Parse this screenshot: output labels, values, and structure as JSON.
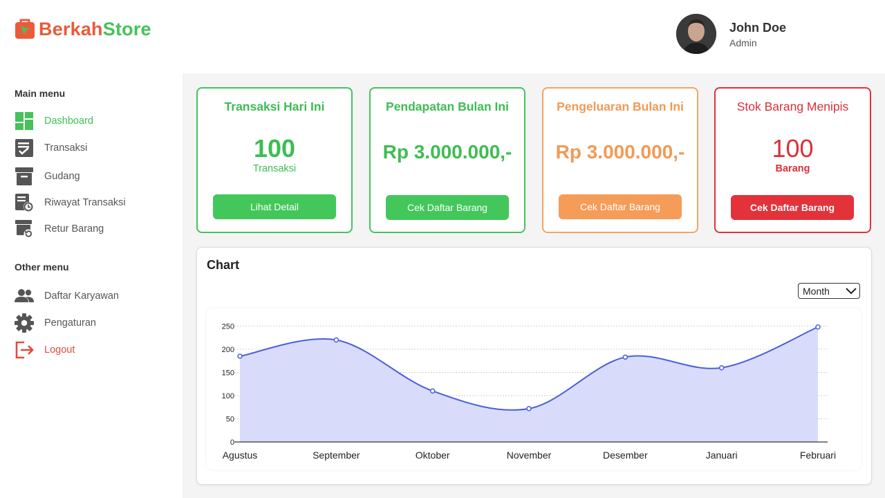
{
  "brand": {
    "part1": "Berkah",
    "part2": "Store"
  },
  "user": {
    "name": "John Doe",
    "role": "Admin"
  },
  "sidebar": {
    "main_title": "Main menu",
    "main_items": [
      {
        "label": "Dashboard",
        "icon": "dashboard-icon",
        "active": true
      },
      {
        "label": "Transaksi",
        "icon": "checklist-icon"
      },
      {
        "label": "Gudang",
        "icon": "archive-box-icon"
      },
      {
        "label": "Riwayat Transaksi",
        "icon": "history-doc-icon"
      },
      {
        "label": "Retur Barang",
        "icon": "return-box-icon"
      }
    ],
    "other_title": "Other menu",
    "other_items": [
      {
        "label": "Daftar Karyawan",
        "icon": "people-icon"
      },
      {
        "label": "Pengaturan",
        "icon": "gear-icon"
      },
      {
        "label": "Logout",
        "icon": "logout-icon"
      }
    ]
  },
  "cards": [
    {
      "title": "Transaksi Hari Ini",
      "value": "100",
      "sub": "Transaksi",
      "button": "Lihat Detail",
      "color": "#45c25a"
    },
    {
      "title": "Pendapatan Bulan Ini",
      "value": "Rp 3.000.000,-",
      "button": "Cek Daftar Barang",
      "color": "#45c25a"
    },
    {
      "title": "Pengeluaran Bulan Ini",
      "value": "Rp 3.000.000,-",
      "button": "Cek Daftar Barang",
      "color": "#f29a55"
    },
    {
      "title": "Stok Barang Menipis",
      "value": "100",
      "sub": "Barang",
      "button": "Cek Daftar Barang",
      "color": "#e0313a"
    }
  ],
  "chart_panel": {
    "title": "Chart",
    "period_select": "Month"
  },
  "chart_data": {
    "type": "area",
    "categories": [
      "Agustus",
      "September",
      "Oktober",
      "November",
      "Desember",
      "Januari",
      "Februari"
    ],
    "series": [
      {
        "values": [
          185,
          220,
          110,
          72,
          183,
          160,
          248
        ]
      }
    ],
    "y_ticks": [
      0,
      50,
      100,
      150,
      200,
      250
    ],
    "ylim": [
      0,
      270
    ],
    "grid": true,
    "line_color": "#4a5fd9",
    "fill_color": "#d8dcfa"
  }
}
